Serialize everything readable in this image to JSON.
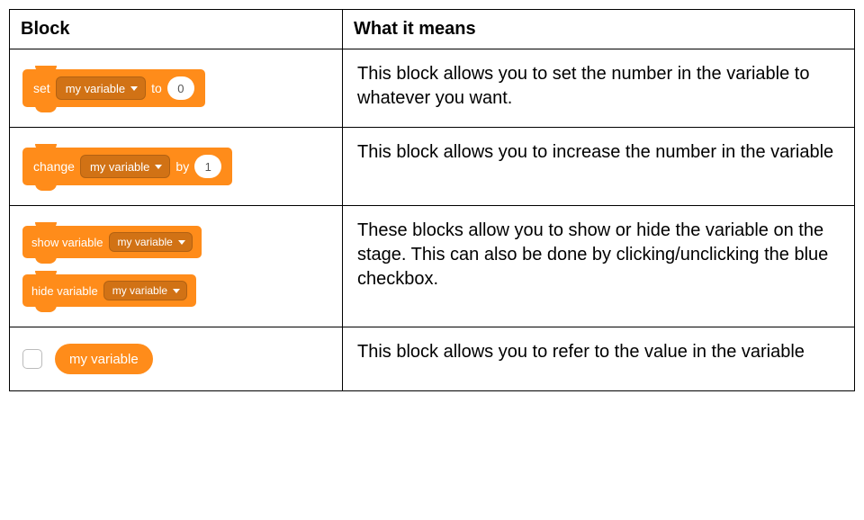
{
  "table": {
    "headers": {
      "block": "Block",
      "meaning": "What it means"
    },
    "rows": [
      {
        "block": {
          "pre": "set",
          "dropdown": "my variable",
          "mid": "to",
          "input": "0"
        },
        "desc": "This block allows you to set the number in the variable to whatever you want."
      },
      {
        "block": {
          "pre": "change",
          "dropdown": "my variable",
          "mid": "by",
          "input": "1"
        },
        "desc": "This block allows you to increase the number in the variable"
      },
      {
        "block": {
          "show_pre": "show variable",
          "show_dropdown": "my variable",
          "hide_pre": "hide variable",
          "hide_dropdown": "my variable"
        },
        "desc": "These blocks allow you to show or hide the variable on the stage. This can also be done by clicking/unclicking the blue checkbox."
      },
      {
        "block": {
          "reporter": "my variable"
        },
        "desc": "This block allows you to refer to the value in the variable"
      }
    ]
  }
}
